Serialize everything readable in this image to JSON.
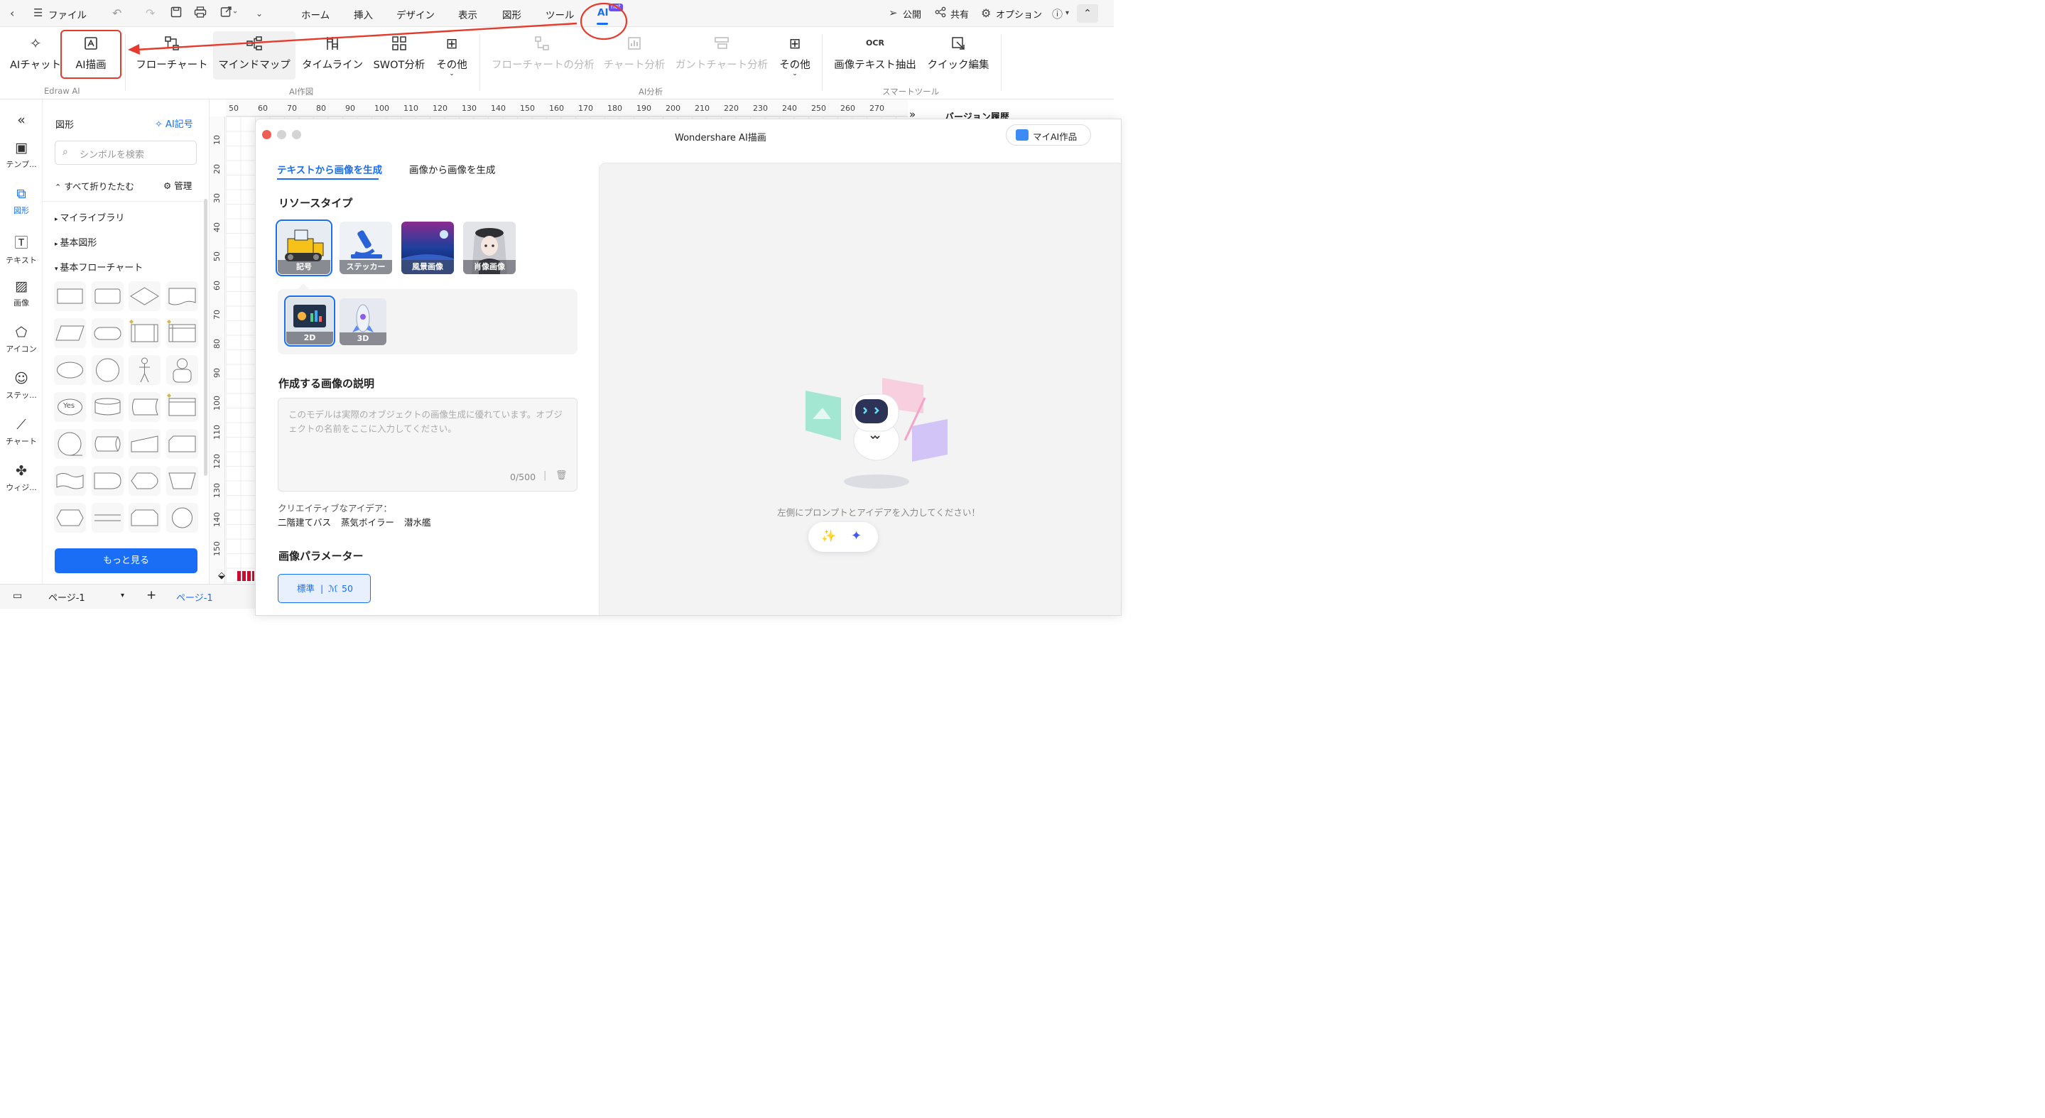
{
  "topbar": {
    "file": "ファイル",
    "menus": [
      "ホーム",
      "挿入",
      "デザイン",
      "表示",
      "図形",
      "ツール",
      "AI"
    ],
    "ai_badge": "hot",
    "publish": "公開",
    "share": "共有",
    "options": "オプション"
  },
  "ribbon": {
    "edraw_ai": {
      "ai_chat": "AIチャット",
      "ai_draw": "AI描画",
      "group": "Edraw AI"
    },
    "ai_create": {
      "flowchart": "フローチャート",
      "mindmap": "マインドマップ",
      "timeline": "タイムライン",
      "swot": "SWOT分析",
      "other": "その他",
      "group": "AI作図"
    },
    "ai_analysis": {
      "flow_analysis": "フローチャートの分析",
      "chart_analysis": "チャート分析",
      "gantt_analysis": "ガントチャート分析",
      "other": "その他",
      "group": "AI分析"
    },
    "smart_tools": {
      "ocr": "画像テキスト抽出",
      "quick_edit": "クイック編集",
      "group": "スマートツール"
    }
  },
  "leftnav": [
    "テンプ...",
    "図形",
    "テキスト",
    "画像",
    "アイコン",
    "ステッ...",
    "チャート",
    "ウィジ..."
  ],
  "panel": {
    "title": "図形",
    "ai_symbol": "AI記号",
    "search_placeholder": "シンボルを検索",
    "collapse_all": "すべて折りたたむ",
    "manage": "管理",
    "tree": [
      "マイライブラリ",
      "基本図形",
      "基本フローチャート"
    ],
    "yes_label": "Yes",
    "more": "もっと見る"
  },
  "ruler": {
    "h": [
      "50",
      "60",
      "70",
      "80",
      "90",
      "100",
      "110",
      "120",
      "130",
      "140",
      "150",
      "160",
      "170",
      "180",
      "190",
      "200",
      "210",
      "220",
      "230",
      "240",
      "250",
      "260",
      "270"
    ],
    "v": [
      "10",
      "20",
      "30",
      "40",
      "50",
      "60",
      "70",
      "80",
      "90",
      "100",
      "110",
      "120",
      "130",
      "140",
      "150"
    ]
  },
  "history_title": "バージョン履歴",
  "bottombar": {
    "page_dropdown": "ページ-1",
    "page_tab": "ページ-1"
  },
  "dialog": {
    "title": "Wondershare AI描画",
    "my_works": "マイAI作品",
    "tab_text": "テキストから画像を生成",
    "tab_image": "画像から画像を生成",
    "resource_type": "リソースタイプ",
    "resources": [
      "記号",
      "ステッカー",
      "風景画像",
      "肖像画像"
    ],
    "sub_types": [
      "2D",
      "3D"
    ],
    "description_title": "作成する画像の説明",
    "description_placeholder": "このモデルは実際のオブジェクトの画像生成に優れています。オブジェクトの名前をここに入力してください。",
    "char_count": "0/500",
    "ideas_label": "クリエイティブなアイデア：",
    "ideas": [
      "二階建てバス",
      "蒸気ボイラー",
      "潜水艦"
    ],
    "params_title": "画像パラメーター",
    "param_standard": "標準",
    "param_count": "50",
    "preview_hint": "左側にプロンプトとアイデアを入力してください！"
  }
}
